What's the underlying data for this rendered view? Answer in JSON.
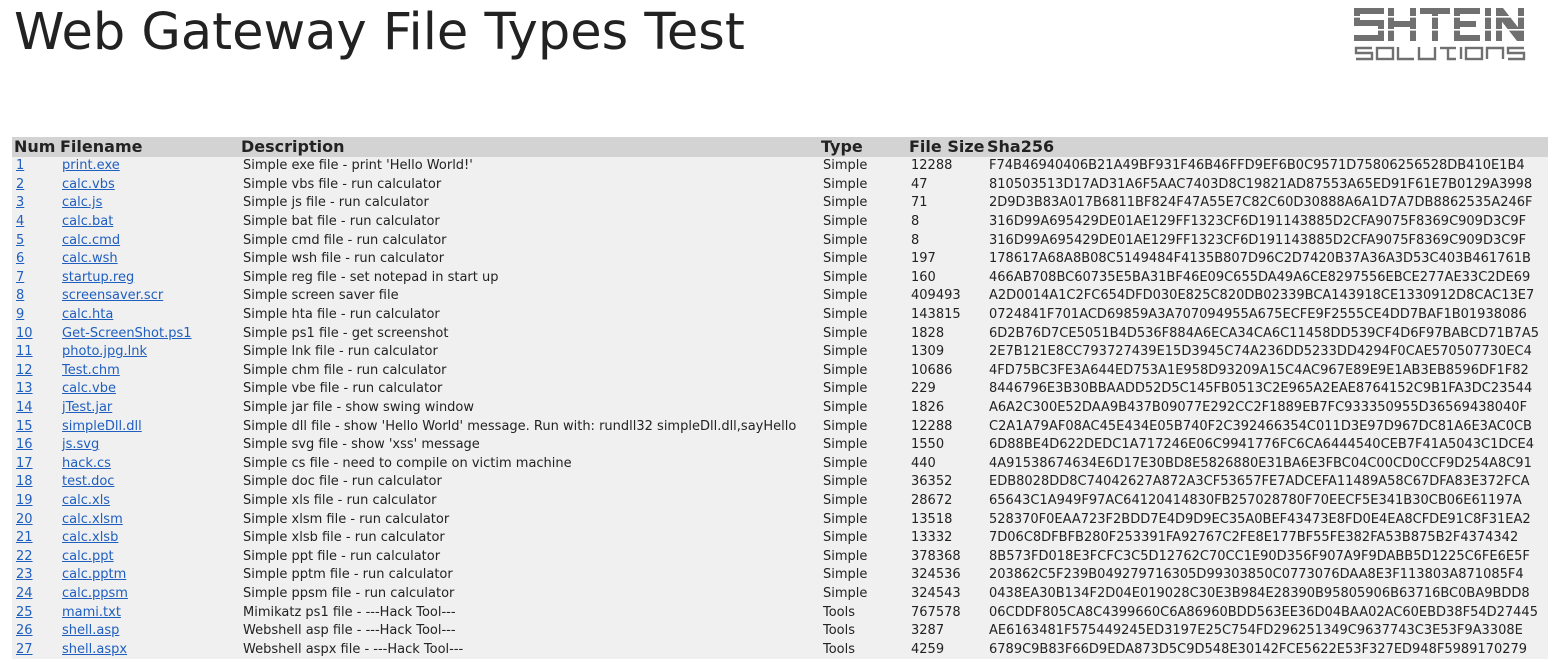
{
  "header": {
    "title": "Web Gateway File Types Test",
    "logo": {
      "line1": "SHTEIN",
      "line2": "SOLUTIONS"
    }
  },
  "table": {
    "columns": [
      "Num",
      "Filename",
      "Description",
      "Type",
      "File Size",
      "Sha256"
    ],
    "rows": [
      {
        "num": "1",
        "filename": "print.exe",
        "description": "Simple exe file - print 'Hello World!'",
        "type": "Simple",
        "size": "12288",
        "sha": "F74B46940406B21A49BF931F46B46FFD9EF6B0C9571D75806256528DB410E1B4"
      },
      {
        "num": "2",
        "filename": "calc.vbs",
        "description": "Simple vbs file - run calculator",
        "type": "Simple",
        "size": "47",
        "sha": "810503513D17AD31A6F5AAC7403D8C19821AD87553A65ED91F61E7B0129A3998"
      },
      {
        "num": "3",
        "filename": "calc.js",
        "description": "Simple js file - run calculator",
        "type": "Simple",
        "size": "71",
        "sha": "2D9D3B83A017B6811BF824F47A55E7C82C60D30888A6A1D7A7DB8862535A246F"
      },
      {
        "num": "4",
        "filename": "calc.bat",
        "description": "Simple bat file - run calculator",
        "type": "Simple",
        "size": "8",
        "sha": "316D99A695429DE01AE129FF1323CF6D191143885D2CFA9075F8369C909D3C9F"
      },
      {
        "num": "5",
        "filename": "calc.cmd",
        "description": "Simple cmd file - run calculator",
        "type": "Simple",
        "size": "8",
        "sha": "316D99A695429DE01AE129FF1323CF6D191143885D2CFA9075F8369C909D3C9F"
      },
      {
        "num": "6",
        "filename": "calc.wsh",
        "description": "Simple wsh file - run calculator",
        "type": "Simple",
        "size": "197",
        "sha": "178617A68A8B08C5149484F4135B807D96C2D7420B37A36A3D53C403B461761B"
      },
      {
        "num": "7",
        "filename": "startup.reg",
        "description": "Simple reg file - set notepad in start up",
        "type": "Simple",
        "size": "160",
        "sha": "466AB708BC60735E5BA31BF46E09C655DA49A6CE8297556EBCE277AE33C2DE69"
      },
      {
        "num": "8",
        "filename": "screensaver.scr",
        "description": "Simple screen saver file",
        "type": "Simple",
        "size": "409493",
        "sha": "A2D0014A1C2FC654DFD030E825C820DB02339BCA143918CE1330912D8CAC13E7"
      },
      {
        "num": "9",
        "filename": "calc.hta",
        "description": "Simple hta file - run calculator",
        "type": "Simple",
        "size": "143815",
        "sha": "0724841F701ACD69859A3A707094955A675ECFE9F2555CE4DD7BAF1B01938086"
      },
      {
        "num": "10",
        "filename": "Get-ScreenShot.ps1",
        "description": "Simple ps1 file - get screenshot",
        "type": "Simple",
        "size": "1828",
        "sha": "6D2B76D7CE5051B4D536F884A6ECA34CA6C11458DD539CF4D6F97BABCD71B7A5"
      },
      {
        "num": "11",
        "filename": "photo.jpg.lnk",
        "description": "Simple lnk file - run calculator",
        "type": "Simple",
        "size": "1309",
        "sha": "2E7B121E8CC793727439E15D3945C74A236DD5233DD4294F0CAE570507730EC4"
      },
      {
        "num": "12",
        "filename": "Test.chm",
        "description": "Simple chm file - run calculator",
        "type": "Simple",
        "size": "10686",
        "sha": "4FD75BC3FE3A644ED753A1E958D93209A15C4AC967E89E9E1AB3EB8596DF1F82"
      },
      {
        "num": "13",
        "filename": "calc.vbe",
        "description": "Simple vbe file - run calculator",
        "type": "Simple",
        "size": "229",
        "sha": "8446796E3B30BBAADD52D5C145FB0513C2E965A2EAE8764152C9B1FA3DC23544"
      },
      {
        "num": "14",
        "filename": "jTest.jar",
        "description": "Simple jar file - show swing window",
        "type": "Simple",
        "size": "1826",
        "sha": "A6A2C300E52DAA9B437B09077E292CC2F1889EB7FC933350955D36569438040F"
      },
      {
        "num": "15",
        "filename": "simpleDll.dll",
        "description": "Simple dll file - show 'Hello World' message. Run with: rundll32 simpleDll.dll,sayHello",
        "type": "Simple",
        "size": "12288",
        "sha": "C2A1A79AF08AC45E434E05B740F2C392466354C011D3E97D967DC81A6E3AC0CB"
      },
      {
        "num": "16",
        "filename": "js.svg",
        "description": "Simple svg file - show 'xss' message",
        "type": "Simple",
        "size": "1550",
        "sha": "6D88BE4D622DEDC1A717246E06C9941776FC6CA6444540CEB7F41A5043C1DCE4"
      },
      {
        "num": "17",
        "filename": "hack.cs",
        "description": "Simple cs file - need to compile on victim machine",
        "type": "Simple",
        "size": "440",
        "sha": "4A91538674634E6D17E30BD8E5826880E31BA6E3FBC04C00CD0CCF9D254A8C91"
      },
      {
        "num": "18",
        "filename": "test.doc",
        "description": "Simple doc file - run calculator",
        "type": "Simple",
        "size": "36352",
        "sha": "EDB8028DD8C74042627A872A3CF53657FE7ADCEFA11489A58C67DFA83E372FCA"
      },
      {
        "num": "19",
        "filename": "calc.xls",
        "description": "Simple xls file - run calculator",
        "type": "Simple",
        "size": "28672",
        "sha": "65643C1A949F97AC64120414830FB257028780F70EECF5E341B30CB06E61197A"
      },
      {
        "num": "20",
        "filename": "calc.xlsm",
        "description": "Simple xlsm file - run calculator",
        "type": "Simple",
        "size": "13518",
        "sha": "528370F0EAA723F2BDD7E4D9D9EC35A0BEF43473E8FD0E4EA8CFDE91C8F31EA2"
      },
      {
        "num": "21",
        "filename": "calc.xlsb",
        "description": "Simple xlsb file - run calculator",
        "type": "Simple",
        "size": "13332",
        "sha": "7D06C8DFBFB280F253391FA92767C2FE8E177BF55FE382FA53B875B2F4374342"
      },
      {
        "num": "22",
        "filename": "calc.ppt",
        "description": "Simple ppt file - run calculator",
        "type": "Simple",
        "size": "378368",
        "sha": "8B573FD018E3FCFC3C5D12762C70CC1E90D356F907A9F9DABB5D1225C6FE6E5F"
      },
      {
        "num": "23",
        "filename": "calc.pptm",
        "description": "Simple pptm file - run calculator",
        "type": "Simple",
        "size": "324536",
        "sha": "203862C5F239B049279716305D99303850C0773076DAA8E3F113803A871085F4"
      },
      {
        "num": "24",
        "filename": "calc.ppsm",
        "description": "Simple ppsm file - run calculator",
        "type": "Simple",
        "size": "324543",
        "sha": "0438EA30B134F2D04E019028C30E3B984E28390B95805906B63716BC0BA9BDD8"
      },
      {
        "num": "25",
        "filename": "mami.txt",
        "description": "Mimikatz ps1 file - ---Hack Tool---",
        "type": "Tools",
        "size": "767578",
        "sha": "06CDDF805CA8C4399660C6A86960BDD563EE36D04BAA02AC60EBD38F54D27445"
      },
      {
        "num": "26",
        "filename": "shell.asp",
        "description": "Webshell asp file - ---Hack Tool---",
        "type": "Tools",
        "size": "3287",
        "sha": "AE6163481F575449245ED3197E25C754FD296251349C9637743C3E53F9A3308E"
      },
      {
        "num": "27",
        "filename": "shell.aspx",
        "description": "Webshell aspx file - ---Hack Tool---",
        "type": "Tools",
        "size": "4259",
        "sha": "6789C9B83F66D9EDA873D5C9D548E30142FCE5622E53F327ED948F5989170279"
      }
    ]
  },
  "colors": {
    "header_bg": "#d3d3d3",
    "row_bg": "#f0f0f0",
    "link": "#1f5fbf",
    "text": "#222222",
    "logo": "#707070"
  }
}
